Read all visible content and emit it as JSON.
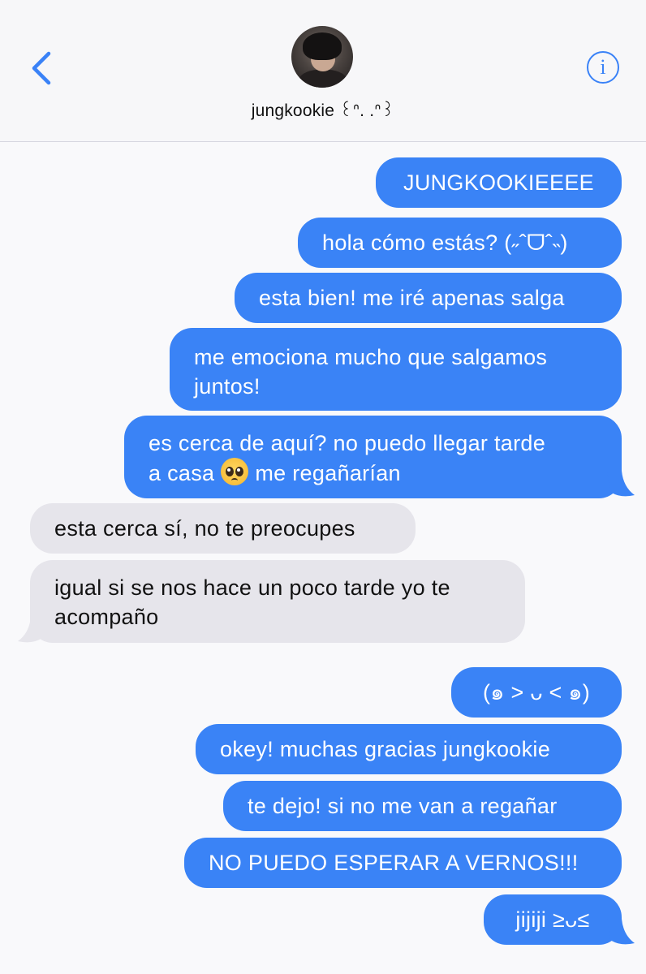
{
  "header": {
    "contact_name": "jungkookie ꒰ᐢ. .ᐢ꒱",
    "back_icon": "chevron-left-icon",
    "info_icon": "info-icon",
    "info_glyph": "i"
  },
  "colors": {
    "sent_bubble": "#3a83f6",
    "received_bubble": "#e6e5eb",
    "accent": "#3a82f7"
  },
  "messages": [
    {
      "from": "me",
      "text": "JUNGKOOKIEEEE"
    },
    {
      "from": "me",
      "text": "hola cómo estás? (˶ˆᗜˆ˵)"
    },
    {
      "from": "me",
      "text": "esta bien! me iré apenas salga"
    },
    {
      "from": "me",
      "line1": "me emociona mucho que salgamos",
      "line2": "juntos!"
    },
    {
      "from": "me",
      "line1": "es cerca de aquí? no puedo llegar tarde",
      "line2_before": "a casa",
      "emoji": "pleading-face-emoji",
      "line2_after": "me regañarían"
    },
    {
      "from": "them",
      "text": "esta cerca sí, no te preocupes"
    },
    {
      "from": "them",
      "line1": "igual si se nos hace un poco tarde yo te",
      "line2": "acompaño"
    },
    {
      "from": "me",
      "text": "(๑ > ᴗ < ๑)"
    },
    {
      "from": "me",
      "text": "okey! muchas gracias jungkookie"
    },
    {
      "from": "me",
      "text": "te dejo! si no me van a regañar"
    },
    {
      "from": "me",
      "text": "NO PUEDO ESPERAR A VERNOS!!!"
    },
    {
      "from": "me",
      "text": "jijiji ≥ᴗ≤"
    }
  ]
}
